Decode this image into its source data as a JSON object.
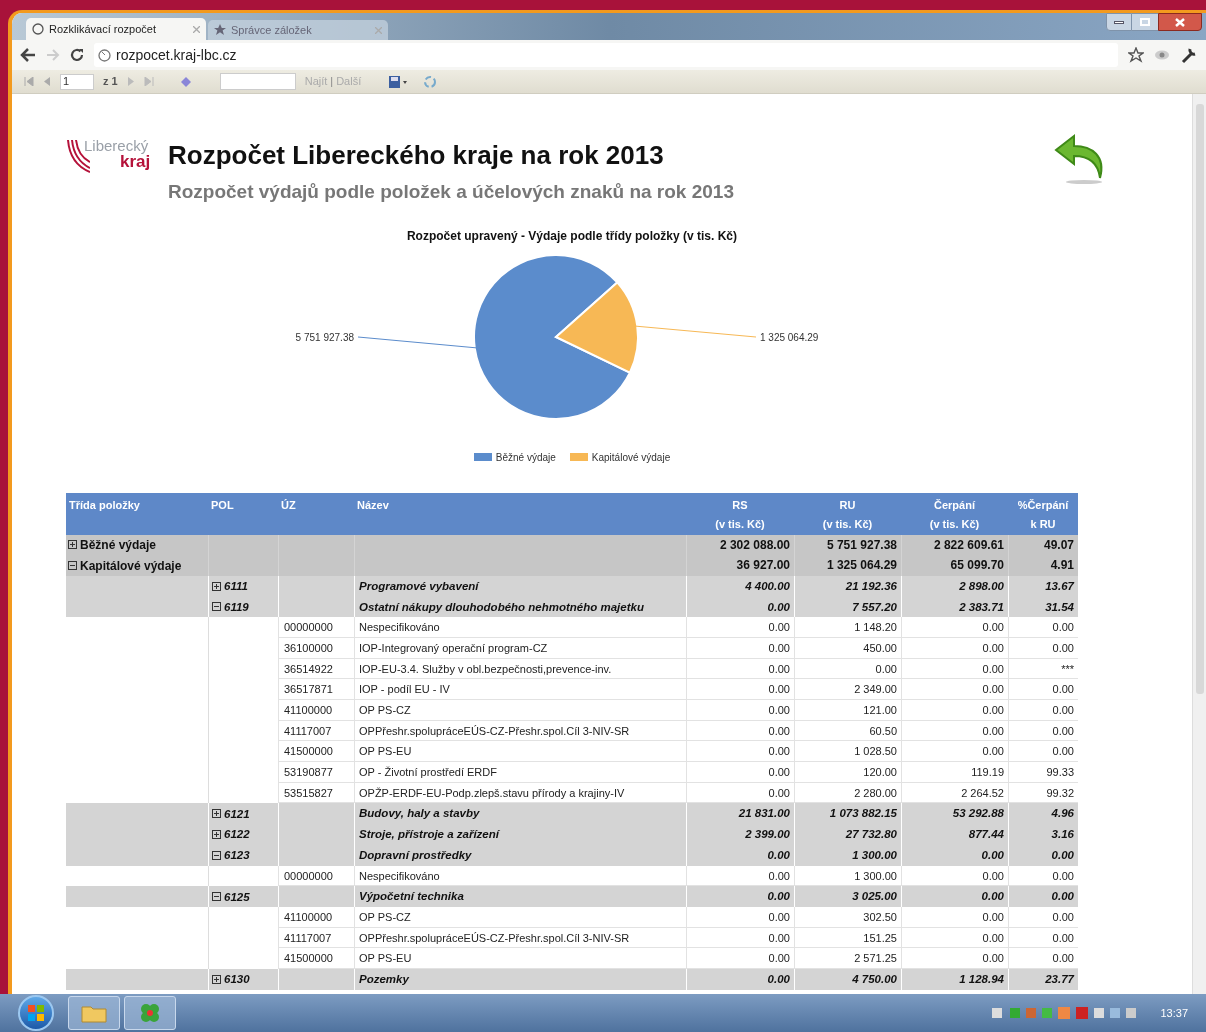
{
  "browser": {
    "tabs": [
      {
        "label": "Rozklikávací rozpočet",
        "selected": true
      },
      {
        "label": "Správce záložek",
        "selected": false
      }
    ],
    "address": "rozpocet.kraj-lbc.cz"
  },
  "report_toolbar": {
    "page": "1",
    "page_count": "z 1",
    "find": "Najít",
    "separator": "|",
    "next": "Další"
  },
  "header": {
    "logo_top": "Liberecký",
    "logo_bottom": "kraj",
    "title": "Rozpočet Libereckého kraje na rok 2013",
    "subtitle": "Rozpočet výdajů podle položek a účelových znaků na rok 2013"
  },
  "chart_data": {
    "type": "pie",
    "title": "Rozpočet upravený - Výdaje podle třídy položky (v tis. Kč)",
    "categories": [
      "Běžné výdaje",
      "Kapitálové výdaje"
    ],
    "series": [
      {
        "values": [
          5751927.38,
          1325064.29
        ]
      }
    ],
    "data_labels": true,
    "legend": "bottom"
  },
  "table": {
    "columns": [
      {
        "label": "Třída položky"
      },
      {
        "label": "POL"
      },
      {
        "label": "ÚZ"
      },
      {
        "label": "Název"
      },
      {
        "label": "RS",
        "unit": "(v tis. Kč)"
      },
      {
        "label": "RU",
        "unit": "(v tis. Kč)"
      },
      {
        "label": "Čerpání",
        "unit": "(v tis. Kč)"
      },
      {
        "label": "%Čerpání",
        "unit": "k RU"
      }
    ],
    "rows": [
      {
        "kind": "class",
        "label": "Běžné výdaje",
        "expanded": false,
        "values": [
          "2 302 088.00",
          "5 751 927.38",
          "2 822 609.61",
          "49.07"
        ]
      },
      {
        "kind": "class",
        "label": "Kapitálové výdaje",
        "expanded": true,
        "values": [
          "36 927.00",
          "1 325 064.29",
          "65 099.70",
          "4.91"
        ],
        "children": [
          {
            "kind": "item",
            "code": "6111",
            "name": "Programové vybavení",
            "expanded": false,
            "values": [
              "4 400.00",
              "21 192.36",
              "2 898.00",
              "13.67"
            ]
          },
          {
            "kind": "item",
            "code": "6119",
            "name": "Ostatní nákupy dlouhodobého nehmotného majetku",
            "expanded": true,
            "values": [
              "0.00",
              "7 557.20",
              "2 383.71",
              "31.54"
            ],
            "children": [
              {
                "kind": "mark",
                "code": "00000000",
                "name": "Nespecifikováno",
                "values": [
                  "0.00",
                  "1 148.20",
                  "0.00",
                  "0.00"
                ]
              },
              {
                "kind": "mark",
                "code": "36100000",
                "name": "IOP-Integrovaný operační program-CZ",
                "values": [
                  "0.00",
                  "450.00",
                  "0.00",
                  "0.00"
                ]
              },
              {
                "kind": "mark",
                "code": "36514922",
                "name": "IOP-EU-3.4. Služby v obl.bezpečnosti,prevence-inv.",
                "values": [
                  "0.00",
                  "0.00",
                  "0.00",
                  "***"
                ]
              },
              {
                "kind": "mark",
                "code": "36517871",
                "name": "IOP - podíl EU - IV",
                "values": [
                  "0.00",
                  "2 349.00",
                  "0.00",
                  "0.00"
                ]
              },
              {
                "kind": "mark",
                "code": "41100000",
                "name": "OP PS-CZ",
                "values": [
                  "0.00",
                  "121.00",
                  "0.00",
                  "0.00"
                ]
              },
              {
                "kind": "mark",
                "code": "41117007",
                "name": "OPPřeshr.spolupráceEÚS-CZ-Přeshr.spol.Cíl 3-NIV-SR",
                "values": [
                  "0.00",
                  "60.50",
                  "0.00",
                  "0.00"
                ]
              },
              {
                "kind": "mark",
                "code": "41500000",
                "name": "OP PS-EU",
                "values": [
                  "0.00",
                  "1 028.50",
                  "0.00",
                  "0.00"
                ]
              },
              {
                "kind": "mark",
                "code": "53190877",
                "name": "OP - Životní prostředí ERDF",
                "values": [
                  "0.00",
                  "120.00",
                  "119.19",
                  "99.33"
                ]
              },
              {
                "kind": "mark",
                "code": "53515827",
                "name": "OPŽP-ERDF-EU-Podp.zlepš.stavu přírody a krajiny-IV",
                "values": [
                  "0.00",
                  "2 280.00",
                  "2 264.52",
                  "99.32"
                ]
              }
            ]
          },
          {
            "kind": "item",
            "code": "6121",
            "name": "Budovy, haly a stavby",
            "expanded": false,
            "values": [
              "21 831.00",
              "1 073 882.15",
              "53 292.88",
              "4.96"
            ]
          },
          {
            "kind": "item",
            "code": "6122",
            "name": "Stroje, přístroje a zařízení",
            "expanded": false,
            "values": [
              "2 399.00",
              "27 732.80",
              "877.44",
              "3.16"
            ]
          },
          {
            "kind": "item",
            "code": "6123",
            "name": "Dopravní prostředky",
            "expanded": true,
            "values": [
              "0.00",
              "1 300.00",
              "0.00",
              "0.00"
            ],
            "children": [
              {
                "kind": "mark",
                "code": "00000000",
                "name": "Nespecifikováno",
                "values": [
                  "0.00",
                  "1 300.00",
                  "0.00",
                  "0.00"
                ]
              }
            ]
          },
          {
            "kind": "item",
            "code": "6125",
            "name": "Výpočetní technika",
            "expanded": true,
            "values": [
              "0.00",
              "3 025.00",
              "0.00",
              "0.00"
            ],
            "children": [
              {
                "kind": "mark",
                "code": "41100000",
                "name": "OP PS-CZ",
                "values": [
                  "0.00",
                  "302.50",
                  "0.00",
                  "0.00"
                ]
              },
              {
                "kind": "mark",
                "code": "41117007",
                "name": "OPPřeshr.spolupráceEÚS-CZ-Přeshr.spol.Cíl 3-NIV-SR",
                "values": [
                  "0.00",
                  "151.25",
                  "0.00",
                  "0.00"
                ]
              },
              {
                "kind": "mark",
                "code": "41500000",
                "name": "OP PS-EU",
                "values": [
                  "0.00",
                  "2 571.25",
                  "0.00",
                  "0.00"
                ]
              }
            ]
          },
          {
            "kind": "item",
            "code": "6130",
            "name": "Pozemky",
            "expanded": false,
            "values": [
              "0.00",
              "4 750.00",
              "1 128.94",
              "23.77"
            ]
          }
        ]
      }
    ]
  },
  "taskbar": {
    "clock": "13:37"
  }
}
